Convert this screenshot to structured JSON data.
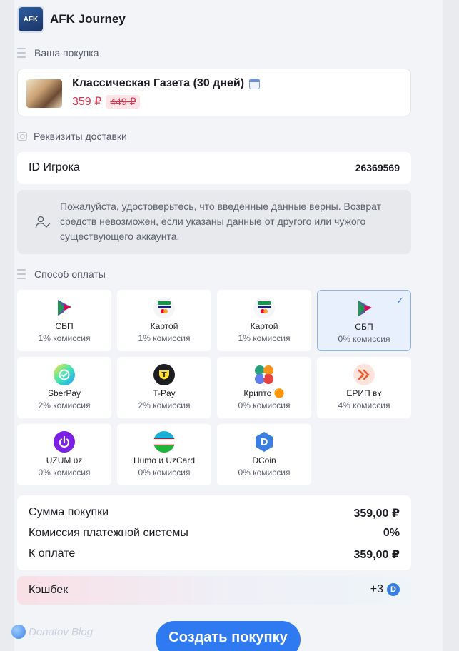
{
  "app": {
    "title": "AFK Journey",
    "logo_text": "AFK"
  },
  "purchase_section": {
    "label": "Ваша покупка"
  },
  "product": {
    "name": "Классическая Газета (30 дней)",
    "price": "359 ₽",
    "old_price": "449 ₽"
  },
  "delivery_section": {
    "label": "Реквизиты доставки"
  },
  "player": {
    "label": "ID Игрока",
    "value": "26369569"
  },
  "notice": {
    "text": "Пожалуйста, удостоверьтесь, что введенные данные верны. Возврат средств невозможен, если указаны данные от другого или чужого существующего аккаунта."
  },
  "payment_section": {
    "label": "Способ оплаты"
  },
  "payment_methods": [
    {
      "name": "СБП",
      "fee": "1% комиссия",
      "icon": "sbp-icon",
      "color": "#ffffff",
      "selected": false
    },
    {
      "name": "Картой",
      "fee": "1% комиссия",
      "icon": "mir-visa-card-icon",
      "color": "#ffffff",
      "selected": false
    },
    {
      "name": "Картой",
      "fee": "1% комиссия",
      "icon": "mir-visa-card-icon",
      "color": "#ffffff",
      "selected": false
    },
    {
      "name": "СБП",
      "fee": "0% комиссия",
      "icon": "sbp-icon",
      "color": "#ffffff",
      "selected": true
    },
    {
      "name": "SberPay",
      "fee": "2% комиссия",
      "icon": "sberpay-icon",
      "color": "#21a038",
      "selected": false
    },
    {
      "name": "T-Pay",
      "fee": "2% комиссия",
      "icon": "tpay-icon",
      "color": "#1b1d22",
      "selected": false
    },
    {
      "name": "Крипто 🟠",
      "fee": "0% комиссия",
      "icon": "crypto-icon",
      "color": "#26a17b",
      "selected": false
    },
    {
      "name": "ЕРИП ʙʏ",
      "fee": "4% комиссия",
      "icon": "erip-icon",
      "color": "#fde3dc",
      "selected": false
    },
    {
      "name": "UZUM ᴜᴢ",
      "fee": "0% комиссия",
      "icon": "uzum-icon",
      "color": "#7b1fe6",
      "selected": false
    },
    {
      "name": "Humo и UzCard",
      "fee": "0% комиссия",
      "icon": "uzbekistan-flag-icon",
      "color": "#1eb53a",
      "selected": false
    },
    {
      "name": "DCoin",
      "fee": "0% комиссия",
      "icon": "dcoin-icon",
      "color": "#3a7fe0",
      "selected": false
    }
  ],
  "summary": {
    "subtotal_label": "Сумма покупки",
    "subtotal_value": "359,00 ₽",
    "fee_label": "Комиссия платежной системы",
    "fee_value": "0%",
    "total_label": "К оплате",
    "total_value": "359,00 ₽"
  },
  "cashback": {
    "label": "Кэшбек",
    "value": "+3",
    "coin_glyph": "D"
  },
  "watermark": {
    "text": "Donatov Blog"
  },
  "submit": {
    "label": "Создать покупку"
  }
}
